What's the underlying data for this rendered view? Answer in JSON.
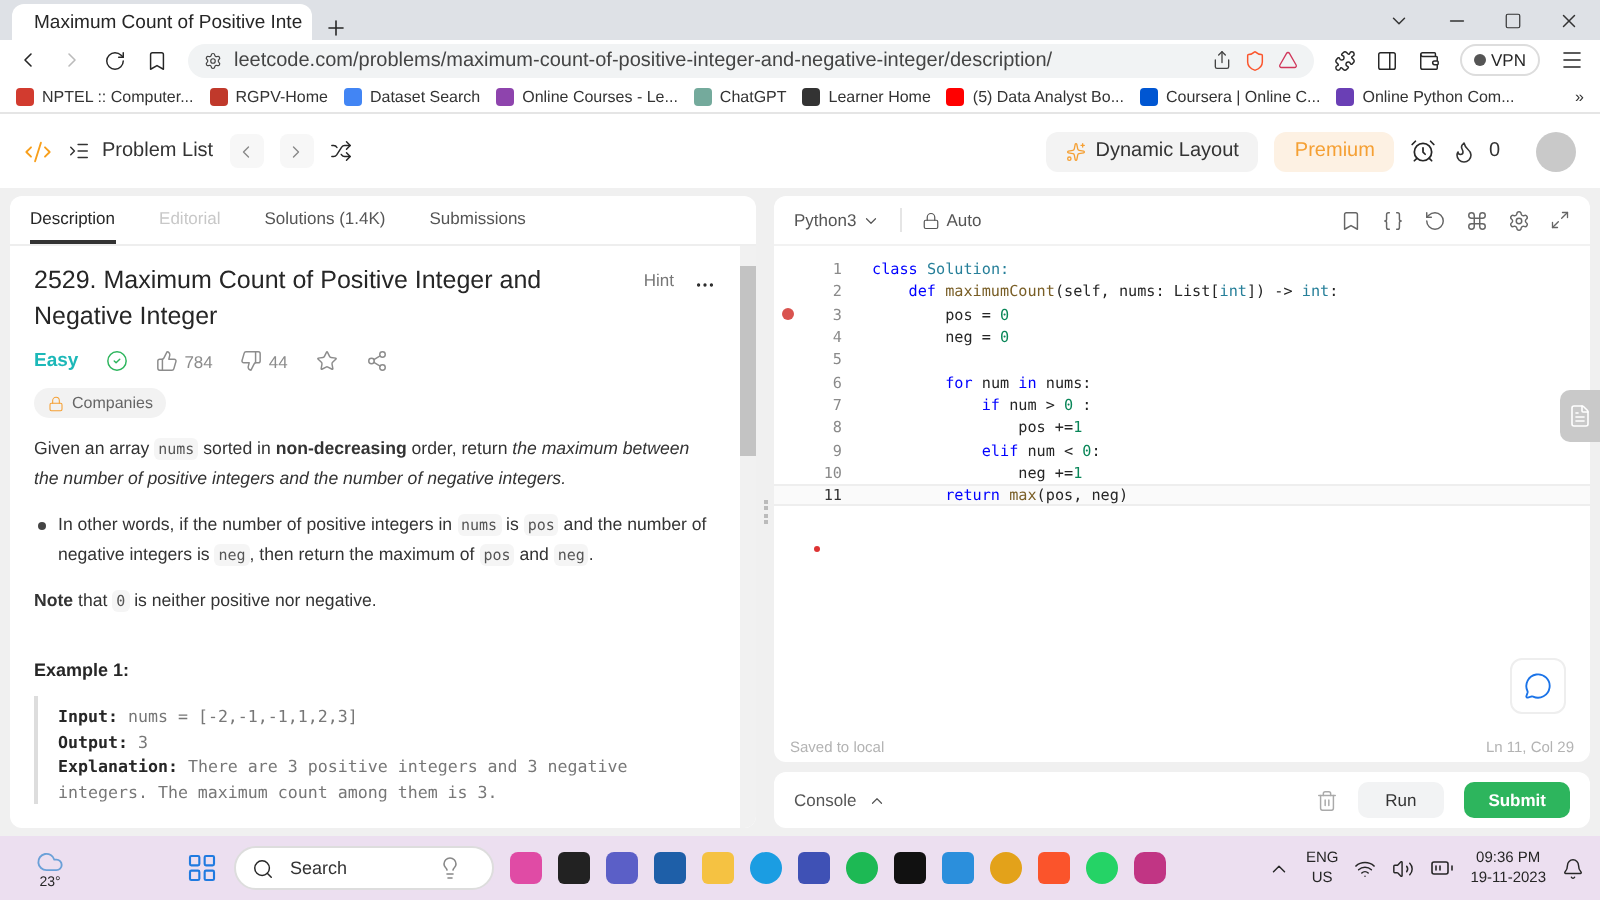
{
  "browser": {
    "tab_title": "Maximum Count of Positive Inte",
    "url": "leetcode.com/problems/maximum-count-of-positive-integer-and-negative-integer/description/",
    "vpn": "VPN",
    "bookmarks": [
      {
        "label": "NPTEL :: Computer...",
        "color": "#d23b2f"
      },
      {
        "label": "RGPV-Home",
        "color": "#c0392b"
      },
      {
        "label": "Dataset Search",
        "color": "#4285f4"
      },
      {
        "label": "Online Courses - Le...",
        "color": "#8e44ad"
      },
      {
        "label": "ChatGPT",
        "color": "#74aa9c"
      },
      {
        "label": "Learner Home",
        "color": "#333333"
      },
      {
        "label": "(5) Data Analyst Bo...",
        "color": "#ff0000"
      },
      {
        "label": "Coursera | Online C...",
        "color": "#0056d2"
      },
      {
        "label": "Online Python Com...",
        "color": "#6a3fb5"
      }
    ],
    "more": "»"
  },
  "nav": {
    "problem_list": "Problem List",
    "dynamic_layout": "Dynamic Layout",
    "premium": "Premium",
    "streak": "0"
  },
  "description": {
    "tabs": [
      {
        "label": "Description",
        "selected": true,
        "disabled": false
      },
      {
        "label": "Editorial",
        "selected": false,
        "disabled": true
      },
      {
        "label": "Solutions (1.4K)",
        "selected": false,
        "disabled": false
      },
      {
        "label": "Submissions",
        "selected": false,
        "disabled": false
      }
    ],
    "title": "2529. Maximum Count of Positive Integer and Negative Integer",
    "hint": "Hint",
    "difficulty": "Easy",
    "solved": true,
    "likes": "784",
    "dislikes": "44",
    "companies": "Companies",
    "paragraph": [
      {
        "text": "Given an array ",
        "kind": "plain"
      },
      {
        "text": "nums",
        "kind": "code"
      },
      {
        "text": " sorted in ",
        "kind": "plain"
      },
      {
        "text": "non-decreasing",
        "kind": "bold"
      },
      {
        "text": " order, return ",
        "kind": "plain"
      },
      {
        "text": "the maximum between the number of positive integers and the number of negative integers.",
        "kind": "italic"
      }
    ],
    "bullet": [
      {
        "text": "In other words, if the number of positive integers in ",
        "kind": "plain"
      },
      {
        "text": "nums",
        "kind": "code"
      },
      {
        "text": " is ",
        "kind": "plain"
      },
      {
        "text": "pos",
        "kind": "code"
      },
      {
        "text": " and the number of negative integers is ",
        "kind": "plain"
      },
      {
        "text": "neg",
        "kind": "code"
      },
      {
        "text": ", then return the maximum of ",
        "kind": "plain"
      },
      {
        "text": "pos",
        "kind": "code"
      },
      {
        "text": " and ",
        "kind": "plain"
      },
      {
        "text": "neg",
        "kind": "code"
      },
      {
        "text": ".",
        "kind": "plain"
      }
    ],
    "note": [
      {
        "text": "Note",
        "kind": "bold"
      },
      {
        "text": " that ",
        "kind": "plain"
      },
      {
        "text": "0",
        "kind": "code"
      },
      {
        "text": " is neither positive nor negative.",
        "kind": "plain"
      }
    ],
    "example_title": "Example 1:",
    "example": [
      {
        "label": "Input:",
        "text": "nums = [-2,-1,-1,1,2,3]"
      },
      {
        "label": "Output:",
        "text": "3"
      },
      {
        "label": "Explanation:",
        "text": "There are 3 positive integers and 3 negative integers. The maximum count among them is 3."
      }
    ]
  },
  "editor": {
    "language": "Python3",
    "mode": "Auto",
    "status": "Saved to local",
    "cursor": "Ln 11, Col 29",
    "lines": [
      {
        "number": "1",
        "breakpoint": false,
        "current": false,
        "tokens": [
          {
            "text": "class ",
            "kind": "keyword"
          },
          {
            "text": "Solution:",
            "kind": "type"
          }
        ]
      },
      {
        "number": "2",
        "breakpoint": false,
        "current": false,
        "tokens": [
          {
            "text": "    def ",
            "kind": "keyword"
          },
          {
            "text": "maximumCount",
            "kind": "fn"
          },
          {
            "text": "(self, nums: List[",
            "kind": "plain"
          },
          {
            "text": "int",
            "kind": "type"
          },
          {
            "text": "]) -> ",
            "kind": "plain"
          },
          {
            "text": "int",
            "kind": "type"
          },
          {
            "text": ":",
            "kind": "plain"
          }
        ]
      },
      {
        "number": "3",
        "breakpoint": true,
        "current": false,
        "tokens": [
          {
            "text": "        pos = ",
            "kind": "plain"
          },
          {
            "text": "0",
            "kind": "number"
          }
        ]
      },
      {
        "number": "4",
        "breakpoint": false,
        "current": false,
        "tokens": [
          {
            "text": "        neg = ",
            "kind": "plain"
          },
          {
            "text": "0",
            "kind": "number"
          }
        ]
      },
      {
        "number": "5",
        "breakpoint": false,
        "current": false
      },
      {
        "number": "6",
        "breakpoint": false,
        "current": false,
        "tokens": [
          {
            "text": "        for ",
            "kind": "keyword"
          },
          {
            "text": "num ",
            "kind": "plain"
          },
          {
            "text": "in ",
            "kind": "keyword"
          },
          {
            "text": "nums:",
            "kind": "plain"
          }
        ]
      },
      {
        "number": "7",
        "breakpoint": false,
        "current": false,
        "tokens": [
          {
            "text": "            if ",
            "kind": "keyword"
          },
          {
            "text": "num > ",
            "kind": "plain"
          },
          {
            "text": "0",
            "kind": "number"
          },
          {
            "text": " :",
            "kind": "plain"
          }
        ]
      },
      {
        "number": "8",
        "breakpoint": false,
        "current": false,
        "tokens": [
          {
            "text": "                pos +=",
            "kind": "plain"
          },
          {
            "text": "1",
            "kind": "number"
          }
        ]
      },
      {
        "number": "9",
        "breakpoint": false,
        "current": false,
        "tokens": [
          {
            "text": "            elif ",
            "kind": "keyword"
          },
          {
            "text": "num < ",
            "kind": "plain"
          },
          {
            "text": "0",
            "kind": "number"
          },
          {
            "text": ":",
            "kind": "plain"
          }
        ]
      },
      {
        "number": "10",
        "breakpoint": false,
        "current": false,
        "tokens": [
          {
            "text": "                neg +=",
            "kind": "plain"
          },
          {
            "text": "1",
            "kind": "number"
          }
        ]
      },
      {
        "number": "11",
        "breakpoint": false,
        "current": true,
        "tokens": [
          {
            "text": "        return ",
            "kind": "keyword"
          },
          {
            "text": "max",
            "kind": "fn"
          },
          {
            "text": "(pos, neg)",
            "kind": "plain"
          }
        ]
      }
    ]
  },
  "console": {
    "label": "Console",
    "run": "Run",
    "submit": "Submit"
  },
  "taskbar": {
    "temperature": "23°",
    "search_placeholder": "Search",
    "language": "ENG",
    "region": "US",
    "time": "09:36 PM",
    "date": "19-11-2023"
  }
}
